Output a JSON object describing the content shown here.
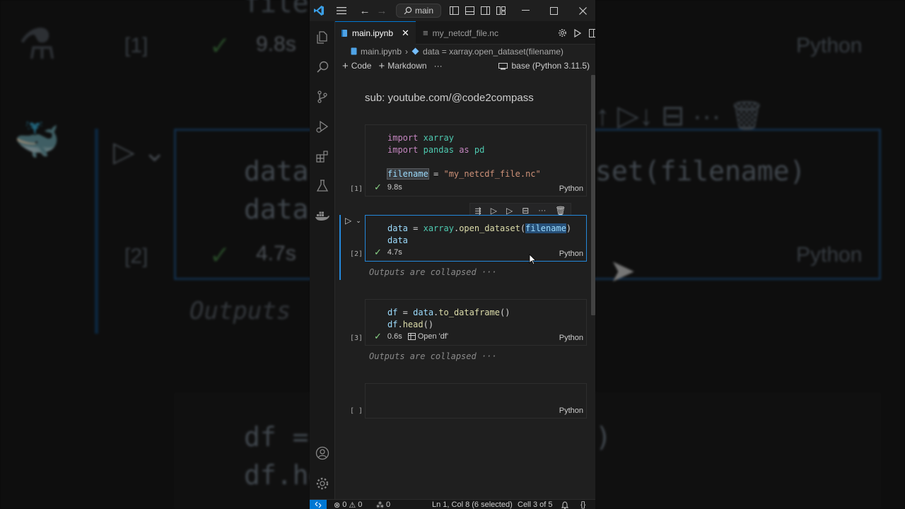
{
  "titlebar": {
    "branch_label": "main"
  },
  "tabs": [
    {
      "label": "main.ipynb",
      "active": true
    },
    {
      "label": "my_netcdf_file.nc",
      "active": false
    }
  ],
  "breadcrumb": {
    "file": "main.ipynb",
    "symbol": "data = xarray.open_dataset(filename)"
  },
  "notebook_toolbar": {
    "code_label": "Code",
    "markdown_label": "Markdown",
    "kernel_label": "base (Python 3.11.5)"
  },
  "markdown_cell": {
    "text": "sub: youtube.com/@code2compass"
  },
  "cells": [
    {
      "exec": "[1]",
      "duration": "9.8s",
      "language": "Python"
    },
    {
      "exec": "[2]",
      "duration": "4.7s",
      "language": "Python"
    },
    {
      "exec": "[3]",
      "duration": "0.6s",
      "language": "Python",
      "variable_link": "Open 'df'"
    },
    {
      "exec": "[ ]",
      "language": "Python"
    }
  ],
  "outputs_collapsed": "Outputs are collapsed ···",
  "statusbar": {
    "errors": "0",
    "warnings": "0",
    "ports": "0",
    "position": "Ln 1, Col 8 (6 selected)",
    "cell": "Cell 3 of 5"
  },
  "background": {
    "exec1": "[1]",
    "dur1": "9.8s",
    "exec2": "[2]",
    "dur2": "4.7s",
    "lang": "Python",
    "code1": "data",
    "code2": "data",
    "code3": "df =",
    "code4": "df.he",
    "code5": "set(filename)",
    "code6": ")",
    "outputs": "Outputs",
    "top": "file"
  },
  "colors": {
    "accent": "#0078d4",
    "check": "#89d185",
    "keyword": "#c586c0",
    "variable": "#9cdcfe",
    "string": "#ce9178"
  }
}
